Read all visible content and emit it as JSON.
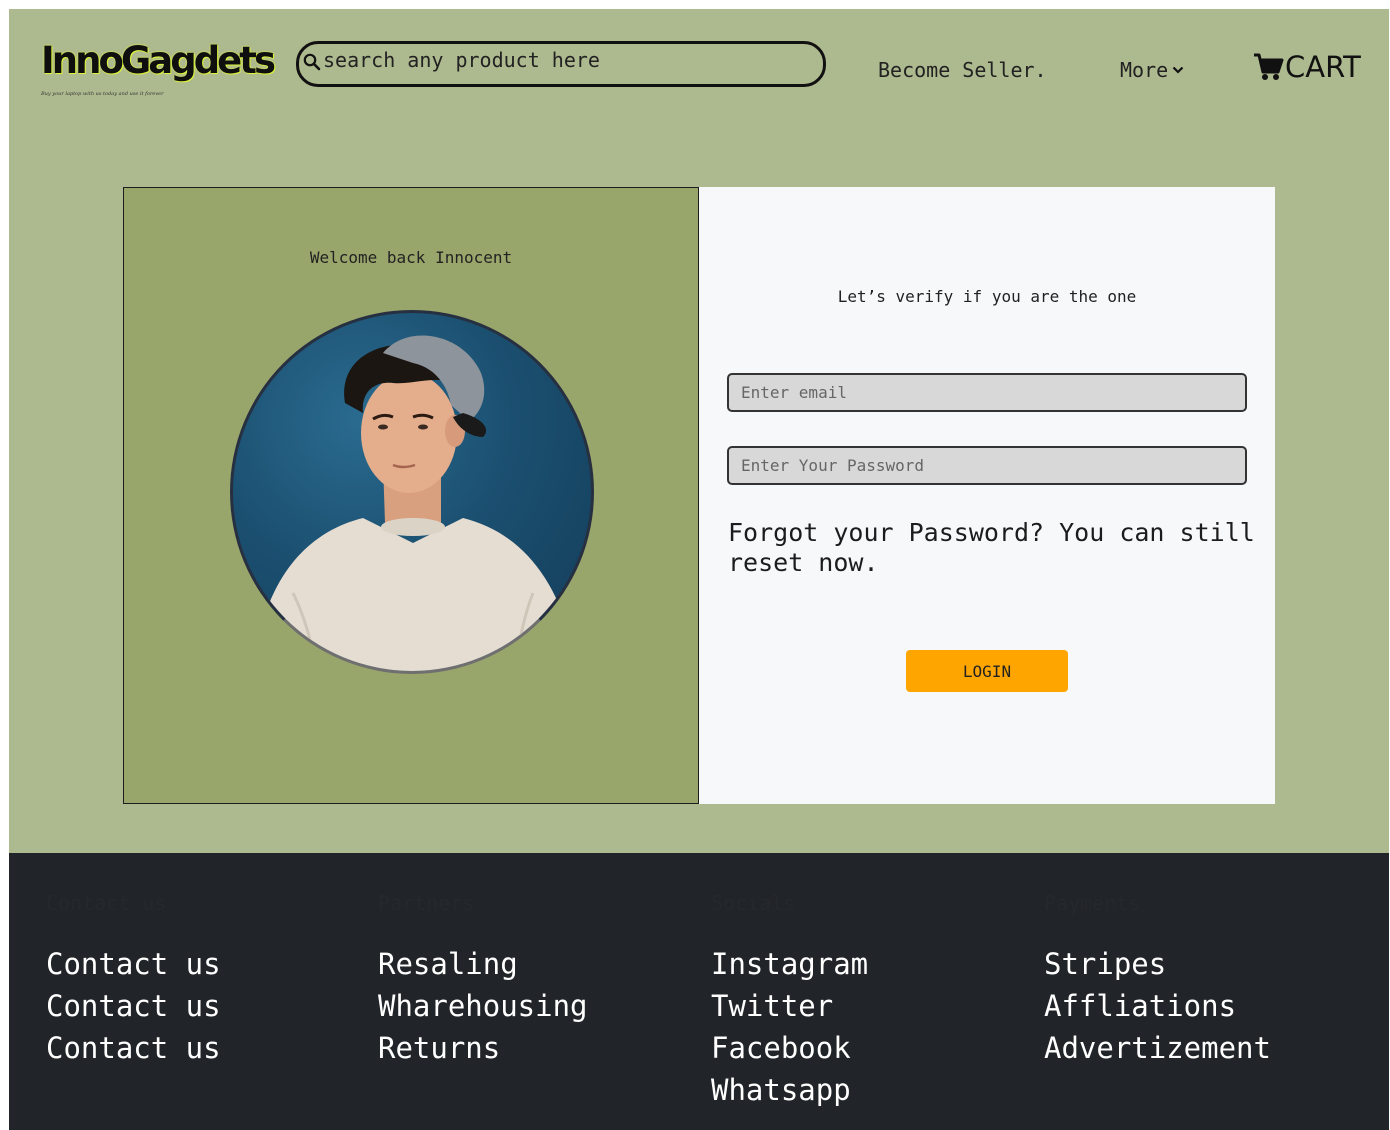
{
  "header": {
    "logo_text": "InnoGagdets",
    "tagline": "Buy your laptop with us today and use it forever",
    "search_placeholder": "search any product here",
    "become_seller": "Become Seller.",
    "more": "More",
    "cart": "CART"
  },
  "login_card": {
    "welcome": "Welcome back Innocent",
    "verify": "Let’s verify if you are the one",
    "email_placeholder": "Enter email",
    "password_placeholder": "Enter Your Password",
    "forgot": "Forgot your Password? You can still reset now.",
    "login_button": "LOGIN"
  },
  "footer": {
    "columns": [
      {
        "title": "Contact us",
        "items": [
          "Contact us",
          "Contact us",
          "Contact us"
        ]
      },
      {
        "title": "Partners",
        "items": [
          "Resaling",
          "Wharehousing",
          "Returns"
        ]
      },
      {
        "title": "Socials",
        "items": [
          "Instagram",
          "Twitter",
          "Facebook",
          "Whatsapp"
        ]
      },
      {
        "title": "Payments",
        "items": [
          "Stripes",
          "Affliations",
          "Advertizement"
        ]
      }
    ]
  },
  "colors": {
    "page_background": "#adb98e",
    "left_panel": "#98a66b",
    "login_button": "#ffa500",
    "footer": "#212428"
  }
}
